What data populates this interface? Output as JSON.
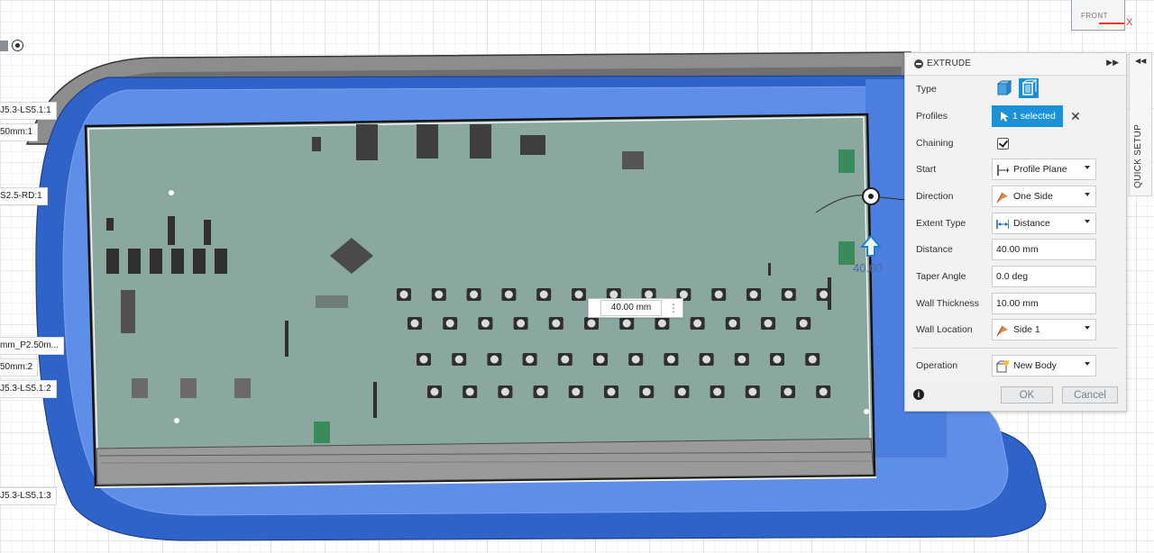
{
  "viewcube": {
    "face_label": "FRONT",
    "axis_label": "X"
  },
  "browser_labels": [
    "J5.3-LS5.1:1",
    "50mm:1",
    "S2.5-RD:1",
    "mm_P2.50m...",
    "50mm:2",
    "J5.3-LS5.1:2",
    "J5.3-LS5.1:3"
  ],
  "viewport": {
    "distance_input_value": "40.00 mm",
    "dimension_label": "40.00"
  },
  "extrude_panel": {
    "title": "EXTRUDE",
    "rows": {
      "type": {
        "label": "Type"
      },
      "profiles": {
        "label": "Profiles",
        "value": "1 selected"
      },
      "chaining": {
        "label": "Chaining",
        "checked": true
      },
      "start": {
        "label": "Start",
        "value": "Profile Plane"
      },
      "direction": {
        "label": "Direction",
        "value": "One Side"
      },
      "extent_type": {
        "label": "Extent Type",
        "value": "Distance"
      },
      "distance": {
        "label": "Distance",
        "value": "40.00 mm"
      },
      "taper_angle": {
        "label": "Taper Angle",
        "value": "0.0 deg"
      },
      "wall_thickness": {
        "label": "Wall Thickness",
        "value": "10.00 mm"
      },
      "wall_location": {
        "label": "Wall Location",
        "value": "Side 1"
      },
      "operation": {
        "label": "Operation",
        "value": "New Body"
      }
    },
    "ok_label": "OK",
    "cancel_label": "Cancel"
  },
  "quick_setup": {
    "label": "QUICK SETUP"
  },
  "colors": {
    "case_blue": "#2f63c7",
    "inner_blue": "#5f8ee8",
    "pcb_green": "#8aa8a0",
    "accent_button": "#1b91d7"
  }
}
